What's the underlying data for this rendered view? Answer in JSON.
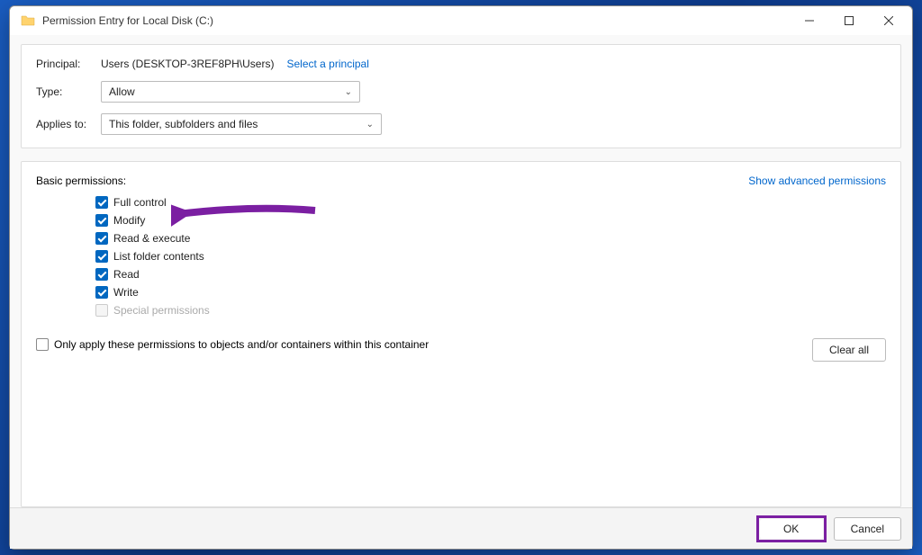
{
  "window": {
    "title": "Permission Entry for Local Disk (C:)"
  },
  "header": {
    "principal_label": "Principal:",
    "principal_value": "Users (DESKTOP-3REF8PH\\Users)",
    "select_principal_link": "Select a principal",
    "type_label": "Type:",
    "type_value": "Allow",
    "applies_label": "Applies to:",
    "applies_value": "This folder, subfolders and files"
  },
  "permissions": {
    "section_label": "Basic permissions:",
    "advanced_link": "Show advanced permissions",
    "items": [
      {
        "label": "Full control",
        "checked": true,
        "disabled": false
      },
      {
        "label": "Modify",
        "checked": true,
        "disabled": false
      },
      {
        "label": "Read & execute",
        "checked": true,
        "disabled": false
      },
      {
        "label": "List folder contents",
        "checked": true,
        "disabled": false
      },
      {
        "label": "Read",
        "checked": true,
        "disabled": false
      },
      {
        "label": "Write",
        "checked": true,
        "disabled": false
      },
      {
        "label": "Special permissions",
        "checked": false,
        "disabled": true
      }
    ],
    "only_apply_label": "Only apply these permissions to objects and/or containers within this container",
    "clear_all_label": "Clear all"
  },
  "footer": {
    "ok_label": "OK",
    "cancel_label": "Cancel"
  }
}
